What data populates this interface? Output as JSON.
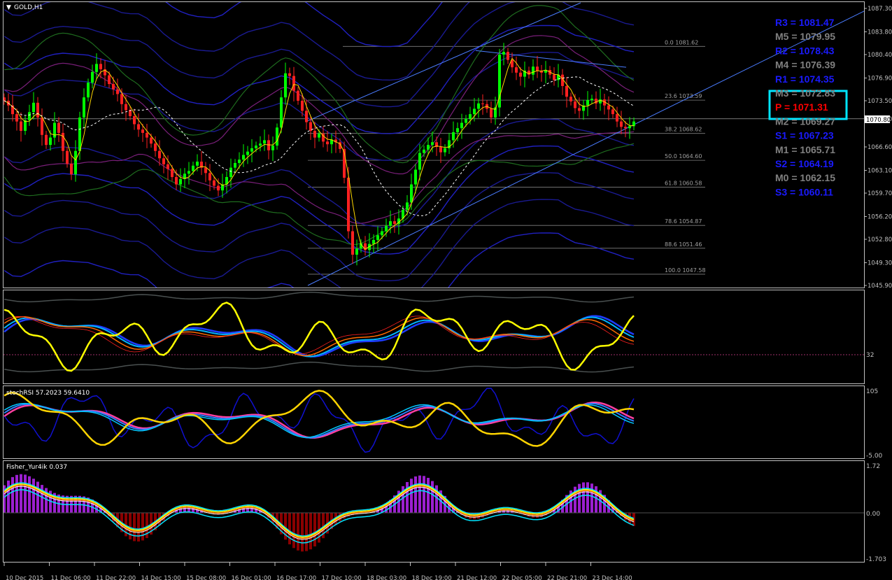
{
  "chart_data": {
    "type": "candlestick",
    "symbol_label": "GOLD,H1",
    "price_axis": {
      "min": 1045.9,
      "max": 1087.3,
      "ticks": [
        "1087.30",
        "1083.80",
        "1080.40",
        "1076.90",
        "1073.50",
        "1070.80",
        "1066.60",
        "1063.10",
        "1059.70",
        "1056.20",
        "1052.80",
        "1049.30",
        "1045.90"
      ]
    },
    "time_axis": [
      "10 Dec 2015",
      "11 Dec 06:00",
      "11 Dec 22:00",
      "14 Dec 15:00",
      "15 Dec 08:00",
      "16 Dec 01:00",
      "16 Dec 17:00",
      "17 Dec 10:00",
      "18 Dec 03:00",
      "18 Dec 19:00",
      "21 Dec 12:00",
      "22 Dec 05:00",
      "22 Dec 21:00",
      "23 Dec 14:00"
    ],
    "fibonacci": [
      {
        "label": "0.0 1081.62",
        "price": 1081.62
      },
      {
        "label": "23.6 1073.59",
        "price": 1073.59
      },
      {
        "label": "38.2 1068.62",
        "price": 1068.62
      },
      {
        "label": "50.0 1064.60",
        "price": 1064.6
      },
      {
        "label": "61.8 1060.58",
        "price": 1060.58
      },
      {
        "label": "78.6 1054.87",
        "price": 1054.87
      },
      {
        "label": "88.6 1051.46",
        "price": 1051.46
      },
      {
        "label": "100.0 1047.58",
        "price": 1047.58
      }
    ],
    "pivots": [
      {
        "label": "R3 = 1081.47",
        "color": "#1a1aff"
      },
      {
        "label": "M5 = 1079.95",
        "color": "#808080"
      },
      {
        "label": "R2 = 1078.43",
        "color": "#1a1aff"
      },
      {
        "label": "M4 = 1076.39",
        "color": "#808080"
      },
      {
        "label": "R1 = 1074.35",
        "color": "#1a1aff"
      },
      {
        "label": "M3 = 1072.83",
        "color": "#808080"
      },
      {
        "label": "P  = 1071.31",
        "color": "#ff0000"
      },
      {
        "label": "M2 = 1069.27",
        "color": "#808080"
      },
      {
        "label": "S1 = 1067.23",
        "color": "#1a1aff"
      },
      {
        "label": "M1 = 1065.71",
        "color": "#808080"
      },
      {
        "label": "S2 = 1064.19",
        "color": "#1a1aff"
      },
      {
        "label": "M0 = 1062.15",
        "color": "#808080"
      },
      {
        "label": "S3 = 1060.11",
        "color": "#1a1aff"
      }
    ],
    "current_price": "1070.80",
    "closes": [
      1073.5,
      1072.8,
      1071.5,
      1070.4,
      1069.0,
      1070.6,
      1071.8,
      1073.2,
      1071.0,
      1068.4,
      1066.9,
      1068.0,
      1070.2,
      1068.7,
      1066.0,
      1064.1,
      1062.5,
      1066.0,
      1071.0,
      1074.0,
      1076.2,
      1077.8,
      1079.0,
      1078.2,
      1077.3,
      1076.0,
      1075.2,
      1074.5,
      1073.0,
      1072.1,
      1071.2,
      1070.0,
      1069.2,
      1068.7,
      1068.0,
      1067.1,
      1066.0,
      1064.9,
      1064.0,
      1063.3,
      1062.1,
      1061.0,
      1061.8,
      1062.6,
      1063.0,
      1063.8,
      1064.4,
      1063.5,
      1062.7,
      1061.6,
      1060.8,
      1060.1,
      1061.0,
      1062.1,
      1063.5,
      1064.2,
      1064.7,
      1065.4,
      1065.9,
      1066.4,
      1066.8,
      1067.1,
      1067.6,
      1066.1,
      1066.8,
      1069.5,
      1074.0,
      1077.6,
      1077.2,
      1075.0,
      1073.5,
      1072.0,
      1070.3,
      1069.0,
      1068.0,
      1068.6,
      1067.4,
      1067.0,
      1067.7,
      1067.3,
      1066.3,
      1062.0,
      1054.0,
      1050.5,
      1051.4,
      1052.2,
      1051.2,
      1052.1,
      1052.7,
      1053.4,
      1054.0,
      1054.8,
      1055.5,
      1055.1,
      1055.9,
      1057.2,
      1058.3,
      1061.0,
      1063.2,
      1065.7,
      1066.2,
      1066.9,
      1067.3,
      1066.6,
      1065.8,
      1066.4,
      1067.6,
      1068.8,
      1069.4,
      1070.2,
      1070.8,
      1071.5,
      1072.3,
      1073.1,
      1073.0,
      1072.3,
      1071.0,
      1072.5,
      1080.4,
      1080.8,
      1079.6,
      1078.5,
      1077.7,
      1077.1,
      1078.0,
      1077.4,
      1078.6,
      1078.0,
      1077.7,
      1078.1,
      1077.4,
      1076.6,
      1077.4,
      1075.7,
      1074.1,
      1073.4,
      1072.4,
      1072.0,
      1072.8,
      1073.6,
      1073.8,
      1073.1,
      1073.7,
      1072.8,
      1072.2,
      1071.5,
      1070.4,
      1069.6,
      1069.4,
      1069.7,
      1070.4
    ]
  },
  "indicators": {
    "panel2": {
      "label": "",
      "level": "32"
    },
    "panel3": {
      "label": "stochRSI 57.2023 59.6410",
      "top": "105",
      "bottom": "-5.00"
    },
    "panel4": {
      "label": "Fisher_Yur4ik 0.037",
      "top": "1.72",
      "mid": "0.00",
      "bottom": "-1.703"
    }
  }
}
